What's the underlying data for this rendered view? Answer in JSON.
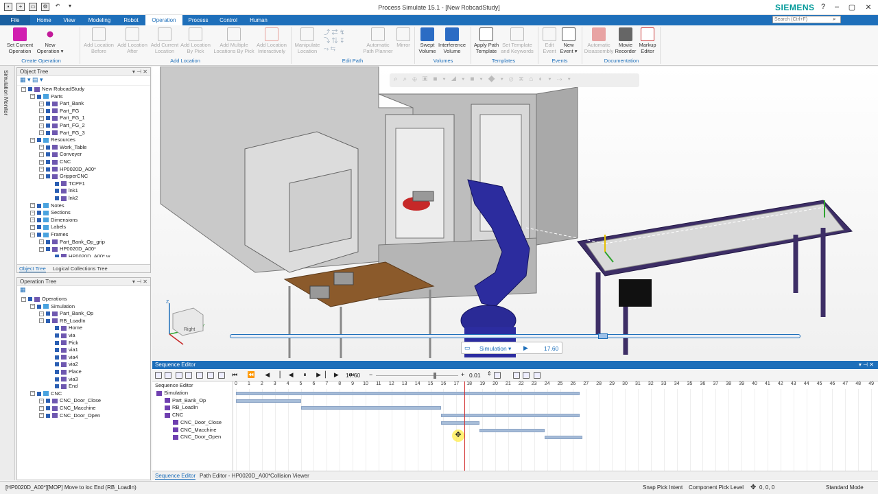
{
  "window": {
    "title": "Process Simulate 15.1 - [New RobcadStudy]",
    "brand": "SIEMENS",
    "search_placeholder": "Search (Ctrl+F)",
    "brand_color": "#009999",
    "accent_color": "#1e6fba"
  },
  "tabs": [
    "File",
    "Home",
    "View",
    "Modeling",
    "Robot",
    "Operation",
    "Process",
    "Control",
    "Human"
  ],
  "active_tab": "Operation",
  "ribbon": {
    "buttons": [
      {
        "label": "Set Current\nOperation",
        "icon": "set-current-operation-icon",
        "enabled": true
      },
      {
        "label": "New\nOperation ▾",
        "icon": "new-operation-icon",
        "enabled": true
      },
      {
        "label": "Add Location\nBefore",
        "icon": "add-location-before-icon",
        "enabled": false
      },
      {
        "label": "Add Location\nAfter",
        "icon": "add-location-after-icon",
        "enabled": false
      },
      {
        "label": "Add Current\nLocation",
        "icon": "add-current-location-icon",
        "enabled": false
      },
      {
        "label": "Add Location\nBy Pick",
        "icon": "add-location-by-pick-icon",
        "enabled": false
      },
      {
        "label": "Add Multiple\nLocations By Pick",
        "icon": "add-multiple-locations-icon",
        "enabled": false
      },
      {
        "label": "Add Location\nInteractively",
        "icon": "add-location-interactively-icon",
        "enabled": false
      },
      {
        "label": "Manipulate\nLocation",
        "icon": "manipulate-location-icon",
        "enabled": false
      },
      {
        "label": "Automatic\nPath Planner",
        "icon": "path-planner-icon",
        "enabled": false
      },
      {
        "label": "Mirror",
        "icon": "mirror-icon",
        "enabled": false
      },
      {
        "label": "Swept\nVolume",
        "icon": "swept-volume-icon",
        "enabled": true
      },
      {
        "label": "Interference\nVolume",
        "icon": "interference-volume-icon",
        "enabled": true
      },
      {
        "label": "Apply Path\nTemplate",
        "icon": "apply-path-template-icon",
        "enabled": true
      },
      {
        "label": "Set Template\nand Keywords",
        "icon": "set-template-icon",
        "enabled": false
      },
      {
        "label": "Edit\nEvent",
        "icon": "edit-event-icon",
        "enabled": false
      },
      {
        "label": "New\nEvent ▾",
        "icon": "new-event-icon",
        "enabled": true
      },
      {
        "label": "Automatic\nDisassembly",
        "icon": "automatic-disassembly-icon",
        "enabled": false
      },
      {
        "label": "Movie\nRecorder",
        "icon": "movie-recorder-icon",
        "enabled": true
      },
      {
        "label": "Markup\nEditor",
        "icon": "markup-editor-icon",
        "enabled": true
      }
    ],
    "groups": [
      "Create Operation",
      "Add Location",
      "Edit Path",
      "Volumes",
      "Templates",
      "Events",
      "Documentation"
    ]
  },
  "side_monitor_label": "Simulation Monitor",
  "object_tree": {
    "title": "Object Tree",
    "items": [
      {
        "label": "New RobcadStudy",
        "depth": 0
      },
      {
        "label": "Parts",
        "depth": 1
      },
      {
        "label": "Part_Bank",
        "depth": 2
      },
      {
        "label": "Part_FG",
        "depth": 2
      },
      {
        "label": "Part_FG_1",
        "depth": 2
      },
      {
        "label": "Part_FG_2",
        "depth": 2
      },
      {
        "label": "Part_FG_3",
        "depth": 2
      },
      {
        "label": "Resources",
        "depth": 1
      },
      {
        "label": "Work_Table",
        "depth": 2
      },
      {
        "label": "Conveyer",
        "depth": 2
      },
      {
        "label": "CNC",
        "depth": 2
      },
      {
        "label": "HP0020D_A00*",
        "depth": 2
      },
      {
        "label": "GripperCNC",
        "depth": 2
      },
      {
        "label": "TCPF1",
        "depth": 3
      },
      {
        "label": "lnk1",
        "depth": 3
      },
      {
        "label": "lnk2",
        "depth": 3
      },
      {
        "label": "Notes",
        "depth": 1
      },
      {
        "label": "Sections",
        "depth": 1
      },
      {
        "label": "Dimensions",
        "depth": 1
      },
      {
        "label": "Labels",
        "depth": 1
      },
      {
        "label": "Frames",
        "depth": 1
      },
      {
        "label": "Part_Bank_Op_grip",
        "depth": 2
      },
      {
        "label": "HP0020D_A00*",
        "depth": 2
      },
      {
        "label": "HP0020D_A00*.w",
        "depth": 3
      }
    ],
    "tabs": [
      "Object Tree",
      "Logical Collections Tree"
    ]
  },
  "operation_tree": {
    "title": "Operation Tree",
    "items": [
      {
        "label": "Operations",
        "depth": 0
      },
      {
        "label": "Simulation",
        "depth": 1
      },
      {
        "label": "Part_Bank_Op",
        "depth": 2
      },
      {
        "label": "RB_LoadIn",
        "depth": 2
      },
      {
        "label": "Home",
        "depth": 3
      },
      {
        "label": "via",
        "depth": 3
      },
      {
        "label": "Pick",
        "depth": 3
      },
      {
        "label": "via1",
        "depth": 3
      },
      {
        "label": "via4",
        "depth": 3
      },
      {
        "label": "via2",
        "depth": 3
      },
      {
        "label": "Place",
        "depth": 3
      },
      {
        "label": "via3",
        "depth": 3
      },
      {
        "label": "End",
        "depth": 3
      },
      {
        "label": "CNC",
        "depth": 1
      },
      {
        "label": "CNC_Door_Close",
        "depth": 2
      },
      {
        "label": "CNC_Macchine",
        "depth": 2
      },
      {
        "label": "CNC_Door_Open",
        "depth": 2
      }
    ]
  },
  "viewport": {
    "sim_label": "Simulation ▾",
    "sim_time": "17.60",
    "cube_label": "Right"
  },
  "sequence_editor": {
    "title": "Sequence Editor",
    "column_header": "Sequence Editor",
    "time_value": "17.60",
    "step_value": "0.01",
    "ticks": [
      "0",
      "1",
      "2",
      "3",
      "4",
      "5",
      "6",
      "7",
      "8",
      "9",
      "10",
      "11",
      "12",
      "13",
      "14",
      "15",
      "16",
      "17",
      "18",
      "19",
      "20",
      "21",
      "22",
      "23",
      "24",
      "25",
      "26",
      "27",
      "28",
      "29",
      "30",
      "31",
      "32",
      "33",
      "34",
      "35",
      "36",
      "37",
      "38",
      "39",
      "40",
      "41",
      "42",
      "43",
      "44",
      "45",
      "46",
      "47",
      "48",
      "49"
    ],
    "current_time": 17.6,
    "rows": [
      {
        "label": "Simulation",
        "depth": 0,
        "start": 0,
        "end": 26.5
      },
      {
        "label": "Part_Bank_Op",
        "depth": 1,
        "start": 0,
        "end": 5
      },
      {
        "label": "RB_LoadIn",
        "depth": 1,
        "start": 5,
        "end": 15.8
      },
      {
        "label": "CNC",
        "depth": 1,
        "start": 15.8,
        "end": 26.5
      },
      {
        "label": "CNC_Door_Close",
        "depth": 2,
        "start": 15.8,
        "end": 18.8
      },
      {
        "label": "CNC_Macchine",
        "depth": 2,
        "start": 18.8,
        "end": 23.8
      },
      {
        "label": "CNC_Door_Open",
        "depth": 2,
        "start": 23.8,
        "end": 26.7
      }
    ],
    "bottom_tabs": [
      "Sequence Editor",
      "Path Editor - HP0020D_A00*",
      "Collision Viewer"
    ]
  },
  "status": {
    "message": "[HP0020D_A00*][MOP] Move to loc End (RB_LoadIn)",
    "snap": "Snap Pick Intent",
    "pick_level": "Component Pick Level",
    "coords": "0, 0, 0",
    "mode": "Standard Mode"
  }
}
